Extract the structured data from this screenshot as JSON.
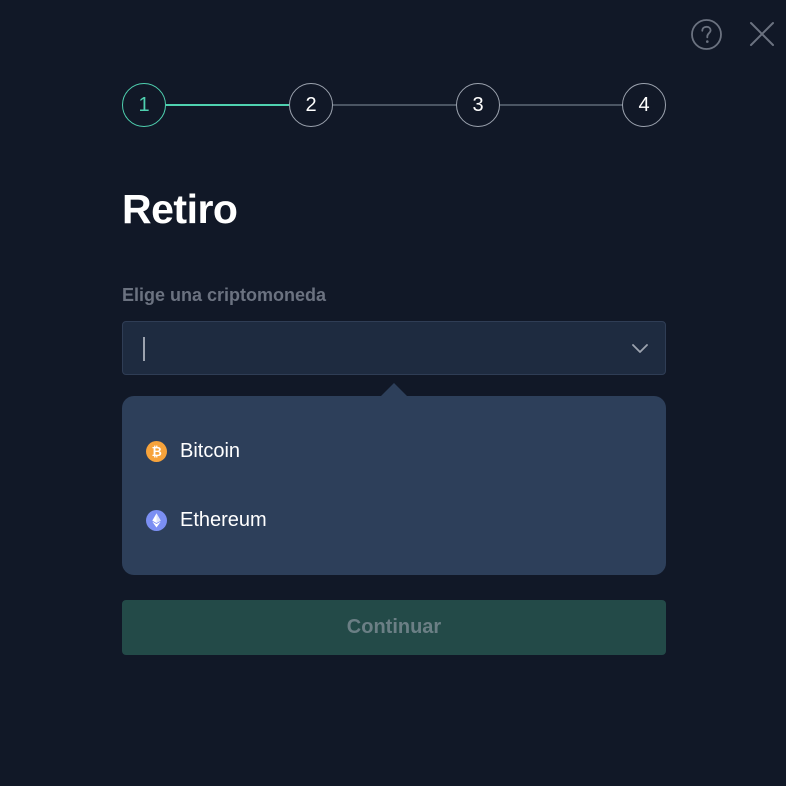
{
  "stepper": {
    "steps": [
      {
        "label": "1",
        "active": true
      },
      {
        "label": "2",
        "active": false
      },
      {
        "label": "3",
        "active": false
      },
      {
        "label": "4",
        "active": false
      }
    ]
  },
  "header": {
    "help_icon": "question-circle-icon",
    "close_icon": "close-icon"
  },
  "main": {
    "title": "Retiro",
    "field_label": "Elige una criptomoneda",
    "select_value": "",
    "dropdown": {
      "options": [
        {
          "label": "Bitcoin",
          "icon": "bitcoin-icon",
          "icon_color": "#f7a33b"
        },
        {
          "label": "Ethereum",
          "icon": "ethereum-icon",
          "icon_color": "#7b8ff3"
        }
      ]
    },
    "continue_label": "Continuar"
  },
  "colors": {
    "background": "#111827",
    "accent": "#4fd1b0",
    "input_bg": "#1e2b40",
    "dropdown_bg": "#2d3f5a",
    "button_bg": "#234a48",
    "button_text": "#6b7f85"
  }
}
